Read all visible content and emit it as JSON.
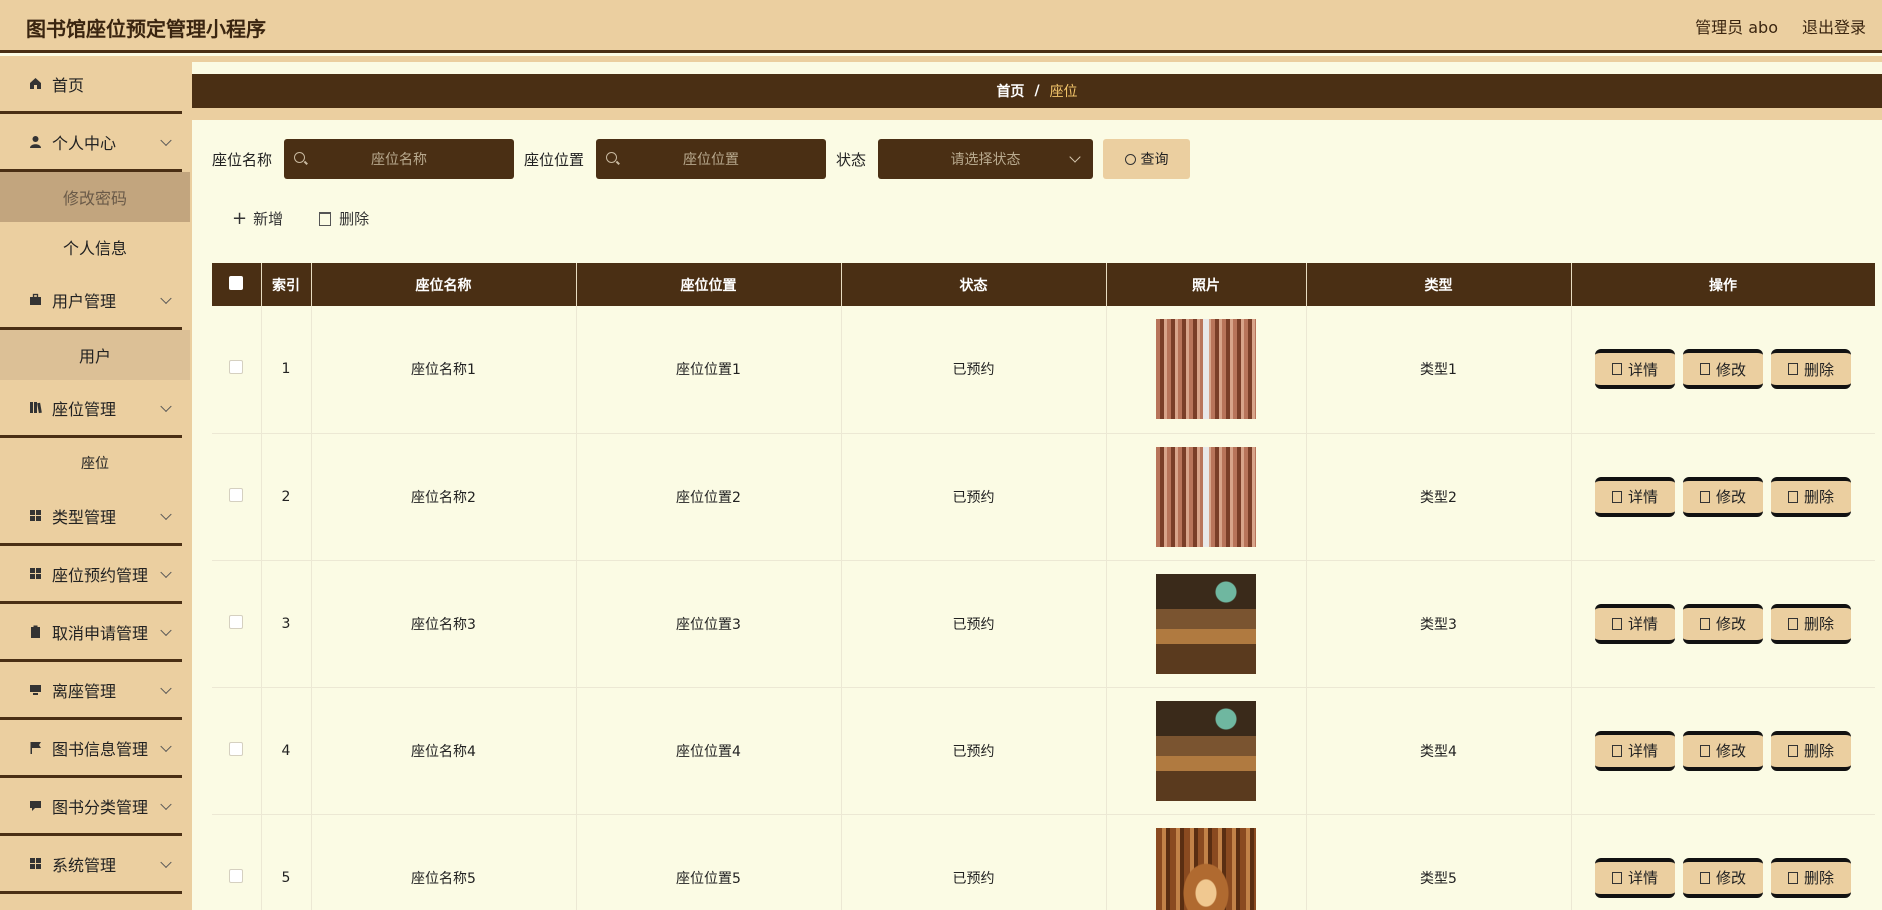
{
  "app": {
    "title": "图书馆座位预定管理小程序",
    "admin_label": "管理员 abo",
    "logout_label": "退出登录"
  },
  "sidebar": {
    "home": "首页",
    "personal_center": "个人中心",
    "change_password": "修改密码",
    "personal_info": "个人信息",
    "user_mgmt": "用户管理",
    "user": "用户",
    "seat_mgmt": "座位管理",
    "seat": "座位",
    "type_mgmt": "类型管理",
    "seat_booking_mgmt": "座位预约管理",
    "cancel_request_mgmt": "取消申请管理",
    "leave_seat_mgmt": "离座管理",
    "book_info_mgmt": "图书信息管理",
    "book_category_mgmt": "图书分类管理",
    "system_mgmt": "系统管理"
  },
  "breadcrumb": {
    "home": "首页",
    "separator": "/",
    "current": "座位"
  },
  "search": {
    "name_label": "座位名称",
    "name_placeholder": "座位名称",
    "position_label": "座位位置",
    "position_placeholder": "座位位置",
    "status_label": "状态",
    "status_placeholder": "请选择状态",
    "query_button": "查询"
  },
  "actions": {
    "add": "新增",
    "delete": "删除"
  },
  "table": {
    "headers": [
      "索引",
      "座位名称",
      "座位位置",
      "状态",
      "照片",
      "类型",
      "操作"
    ],
    "rows": [
      {
        "index": "1",
        "name": "座位名称1",
        "position": "座位位置1",
        "status": "已预约",
        "photo": "hall",
        "type": "类型1"
      },
      {
        "index": "2",
        "name": "座位名称2",
        "position": "座位位置2",
        "status": "已预约",
        "photo": "hall",
        "type": "类型2"
      },
      {
        "index": "3",
        "name": "座位名称3",
        "position": "座位位置3",
        "status": "已预约",
        "photo": "reading",
        "type": "类型3"
      },
      {
        "index": "4",
        "name": "座位名称4",
        "position": "座位位置4",
        "status": "已预约",
        "photo": "reading",
        "type": "类型4"
      },
      {
        "index": "5",
        "name": "座位名称5",
        "position": "座位位置5",
        "status": "已预约",
        "photo": "arch",
        "type": "类型5"
      }
    ],
    "op_detail": "详情",
    "op_edit": "修改",
    "op_delete": "删除"
  },
  "colors": {
    "header_bg": "#ebcfa0",
    "dark_brown": "#4a2f14",
    "page_bg": "#fbfbe4",
    "breadcrumb_current": "#f2c46a"
  }
}
